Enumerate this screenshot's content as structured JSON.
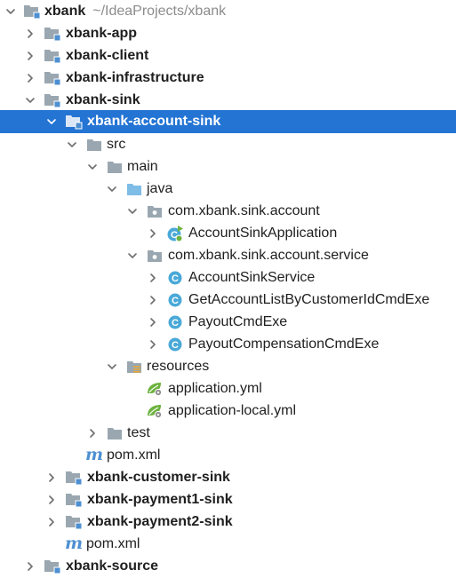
{
  "tree": {
    "root": {
      "label": "xbank",
      "path": "~/IdeaProjects/xbank"
    },
    "items": [
      {
        "label": "xbank-app"
      },
      {
        "label": "xbank-client"
      },
      {
        "label": "xbank-infrastructure"
      },
      {
        "label": "xbank-sink"
      },
      {
        "label": "xbank-account-sink",
        "selected": true
      },
      {
        "label": "src"
      },
      {
        "label": "main"
      },
      {
        "label": "java"
      },
      {
        "label": "com.xbank.sink.account"
      },
      {
        "label": "AccountSinkApplication"
      },
      {
        "label": "com.xbank.sink.account.service"
      },
      {
        "label": "AccountSinkService"
      },
      {
        "label": "GetAccountListByCustomerIdCmdExe"
      },
      {
        "label": "PayoutCmdExe"
      },
      {
        "label": "PayoutCompensationCmdExe"
      },
      {
        "label": "resources"
      },
      {
        "label": "application.yml"
      },
      {
        "label": "application-local.yml"
      },
      {
        "label": "test"
      },
      {
        "label": "pom.xml"
      },
      {
        "label": "xbank-customer-sink"
      },
      {
        "label": "xbank-payment1-sink"
      },
      {
        "label": "xbank-payment2-sink"
      },
      {
        "label": "pom.xml"
      },
      {
        "label": "xbank-source"
      }
    ]
  },
  "colors": {
    "selection": "#2474d4",
    "folder": "#9aa7b0",
    "source_folder": "#7ebde6",
    "class_icon": "#49a9d8",
    "spring": "#6db33f",
    "maven": "#4d8fd1"
  },
  "icons": {
    "expanded": "chevron-down-icon",
    "collapsed": "chevron-right-icon",
    "module": "module-folder-icon",
    "folder": "folder-icon",
    "source_root": "source-root-folder-icon",
    "package": "package-icon",
    "class": "class-icon",
    "spring_app": "spring-boot-class-icon",
    "resources": "resources-folder-icon",
    "yaml": "spring-yaml-icon",
    "maven": "maven-file-icon"
  }
}
